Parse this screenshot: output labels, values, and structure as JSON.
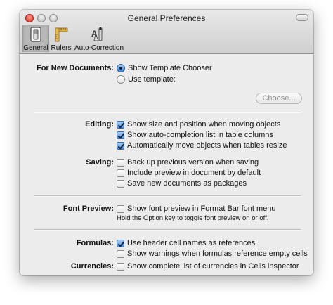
{
  "window": {
    "title": "General Preferences"
  },
  "toolbar": {
    "items": [
      {
        "label": "General",
        "icon": "general-switch-icon",
        "selected": true
      },
      {
        "label": "Rulers",
        "icon": "rulers-icon",
        "selected": false
      },
      {
        "label": "Auto-Correction",
        "icon": "auto-correction-icon",
        "selected": false
      }
    ]
  },
  "new_documents": {
    "label": "For New Documents:",
    "option_template_chooser": "Show Template Chooser",
    "option_use_template": "Use template:",
    "selected": "Show Template Chooser",
    "choose_button": "Choose..."
  },
  "editing": {
    "label": "Editing:",
    "options": [
      {
        "text": "Show size and position when moving objects",
        "checked": true
      },
      {
        "text": "Show auto-completion list in table columns",
        "checked": true
      },
      {
        "text": "Automatically move objects when tables resize",
        "checked": true
      }
    ]
  },
  "saving": {
    "label": "Saving:",
    "options": [
      {
        "text": "Back up previous version when saving",
        "checked": false
      },
      {
        "text": "Include preview in document by default",
        "checked": false
      },
      {
        "text": "Save new documents as packages",
        "checked": false
      }
    ]
  },
  "font_preview": {
    "label": "Font Preview:",
    "option": {
      "text": "Show font preview in Format Bar font menu",
      "checked": false
    },
    "note": "Hold the Option key to toggle font preview on or off."
  },
  "formulas": {
    "label": "Formulas:",
    "options": [
      {
        "text": "Use header cell names as references",
        "checked": true
      },
      {
        "text": "Show warnings when formulas reference empty cells",
        "checked": false
      }
    ]
  },
  "currencies": {
    "label": "Currencies:",
    "option": {
      "text": "Show complete list of currencies in Cells inspector",
      "checked": false
    }
  },
  "colors": {
    "accent": "#4a8fe0",
    "window_bg": "#ececec"
  }
}
